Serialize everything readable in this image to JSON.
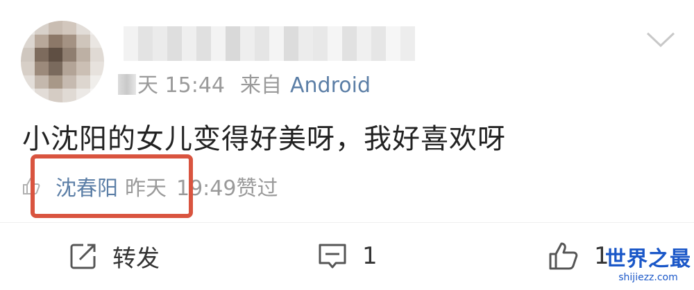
{
  "post": {
    "timestamp": "天 15:44",
    "source_prefix": "来自",
    "source": "Android",
    "content": "小沈阳的女儿变得好美呀，我好喜欢呀"
  },
  "like_info": {
    "liker": "沈春阳",
    "day": "昨天",
    "time": "19:49赞过"
  },
  "actions": {
    "repost_label": "转发",
    "comment_count": "1",
    "like_count": "1"
  },
  "watermark": {
    "title": "世界之最",
    "url": "shijiezz.com"
  },
  "colors": {
    "link": "#5b7ea6",
    "highlight": "#d9543f",
    "muted": "#9a9a9a",
    "watermark": "#1a57c8"
  },
  "icons": [
    "chevron-down-icon",
    "like-icon",
    "repost-icon",
    "comment-icon",
    "thumb-up-icon"
  ]
}
